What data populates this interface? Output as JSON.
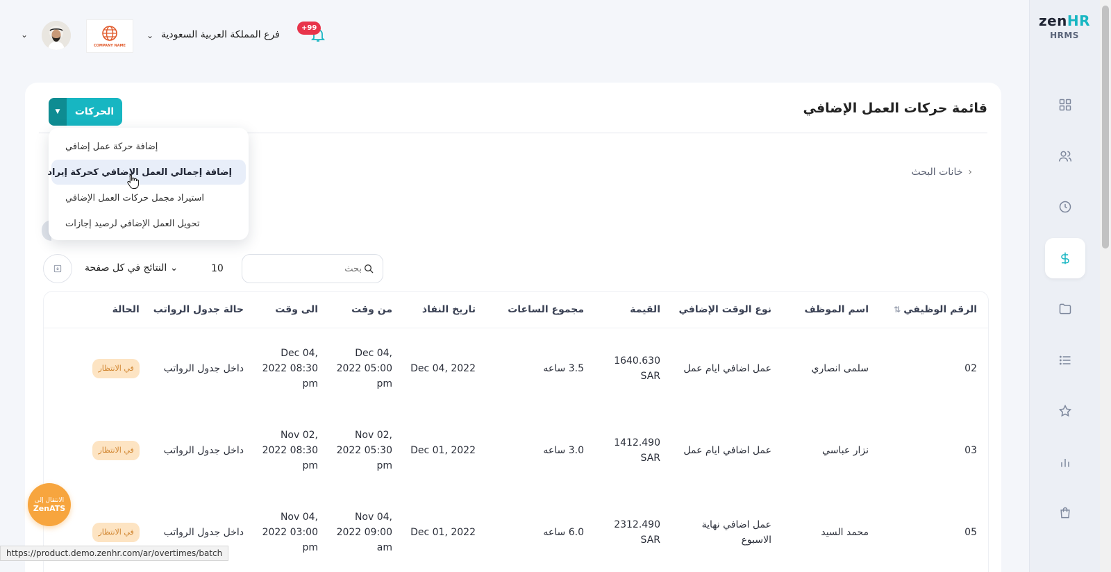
{
  "app": {
    "logo_zen": "zen",
    "logo_hr": "HR",
    "logo_sub": "HRMS"
  },
  "topbar": {
    "branch": "فرع المملكة العربية السعودية",
    "notifications_badge": "+99",
    "company_logo_text": "COMPANY NAME"
  },
  "sidebar": {
    "items": [
      {
        "icon": "dashboard-icon"
      },
      {
        "icon": "users-icon"
      },
      {
        "icon": "clock-icon"
      },
      {
        "icon": "dollar-icon",
        "active": true
      },
      {
        "icon": "folder-icon"
      },
      {
        "icon": "list-icon"
      },
      {
        "icon": "star-icon"
      },
      {
        "icon": "bar-chart-icon"
      },
      {
        "icon": "bag-icon"
      }
    ]
  },
  "page": {
    "title": "قائمة حركات العمل الإضافي",
    "actions_label": "الحركات",
    "search_fields_label": "خانات البحث",
    "search_placeholder": "بحث",
    "per_page_value": "10",
    "per_page_label": "النتائج في كل صفحة"
  },
  "dropdown": {
    "items": [
      "إضافة حركة عمل إضافي",
      "إضافة إجمالي العمل الإضافي كحركة إيراد",
      "استيراد مجمل حركات العمل الإضافي",
      "تحويل العمل الإضافي لرصيد إجازات"
    ]
  },
  "table": {
    "headers": {
      "id": "الرقم الوظيفي",
      "name": "اسم الموظف",
      "type": "نوع الوقت الإضافي",
      "value": "القيمة",
      "hours": "مجموع الساعات",
      "effective": "تاريخ النفاذ",
      "from": "من وقت",
      "to": "الى وقت",
      "payroll": "حالة جدول الرواتب",
      "status": "الحالة"
    },
    "rows": [
      {
        "id": "02",
        "name": "سلمى انصاري",
        "type": "عمل اضافي ايام عمل",
        "value": "1640.630 SAR",
        "hours": "3.5 ساعه",
        "effective": "Dec 04, 2022",
        "from": "Dec 04, 2022 05:00 pm",
        "to": "Dec 04, 2022 08:30 pm",
        "payroll": "داخل جدول الرواتب",
        "status": "في الانتظار"
      },
      {
        "id": "03",
        "name": "نزار عباسي",
        "type": "عمل اضافي ايام عمل",
        "value": "1412.490 SAR",
        "hours": "3.0 ساعه",
        "effective": "Dec 01, 2022",
        "from": "Nov 02, 2022 05:30 pm",
        "to": "Nov 02, 2022 08:30 pm",
        "payroll": "داخل جدول الرواتب",
        "status": "في الانتظار"
      },
      {
        "id": "05",
        "name": "محمد السيد",
        "type": "عمل اضافي نهاية الاسبوع",
        "value": "2312.490 SAR",
        "hours": "6.0 ساعه",
        "effective": "Dec 01, 2022",
        "from": "Nov 04, 2022 09:00 am",
        "to": "Nov 04, 2022 03:00 pm",
        "payroll": "داخل جدول الرواتب",
        "status": "في الانتظار"
      }
    ]
  },
  "ats": {
    "line1": "الانتقال إلى",
    "line2": "ZenATS"
  },
  "status_url": "https://product.demo.zenhr.com/ar/overtimes/batch",
  "colors": {
    "accent": "#17b6c2",
    "accent_dark": "#0e8c92",
    "badge": "#e8344b",
    "pending_bg": "#fde4c3",
    "ats": "#f7a53e"
  }
}
